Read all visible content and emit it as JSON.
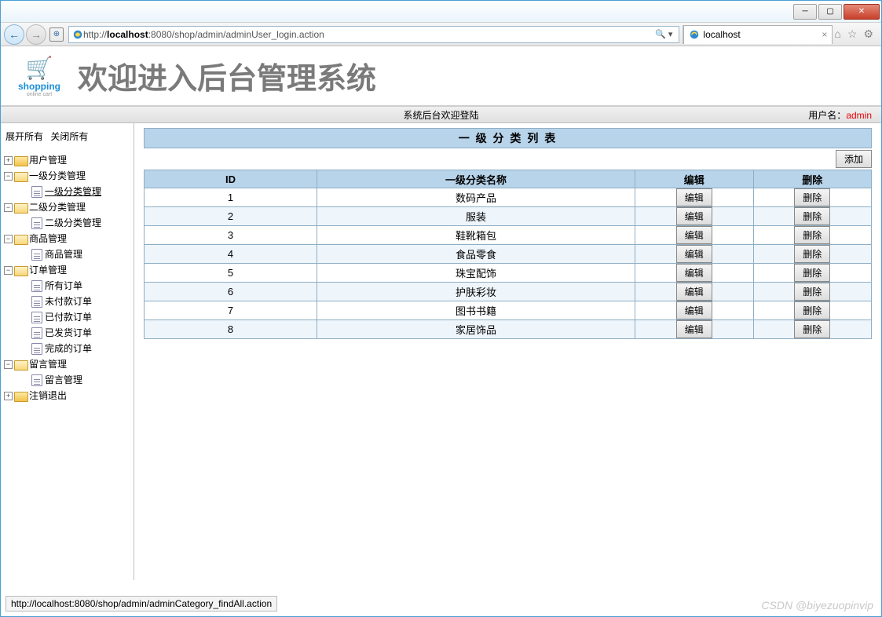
{
  "window": {
    "url_prefix": "http://",
    "url_host": "localhost",
    "url_rest": ":8080/shop/admin/adminUser_login.action",
    "tab_title": "localhost",
    "search_hint": "🔍 ▾"
  },
  "tool_icons": {
    "home": "⌂",
    "star": "☆",
    "gear": "⚙"
  },
  "header": {
    "logo_name": "shopping",
    "logo_sub": "online cart",
    "title": "欢迎进入后台管理系统"
  },
  "info_bar": {
    "center": "系统后台欢迎登陆",
    "user_label": "用户名：",
    "user_name": "admin"
  },
  "sidebar": {
    "expand_all": "展开所有",
    "collapse_all": "关闭所有",
    "nodes": [
      {
        "label": "用户管理",
        "state": "plus",
        "children": []
      },
      {
        "label": "一级分类管理",
        "state": "minus",
        "children": [
          {
            "label": "一级分类管理",
            "active": true
          }
        ]
      },
      {
        "label": "二级分类管理",
        "state": "minus",
        "children": [
          {
            "label": "二级分类管理"
          }
        ]
      },
      {
        "label": "商品管理",
        "state": "minus",
        "children": [
          {
            "label": "商品管理"
          }
        ]
      },
      {
        "label": "订单管理",
        "state": "minus",
        "children": [
          {
            "label": "所有订单"
          },
          {
            "label": "未付款订单"
          },
          {
            "label": "已付款订单"
          },
          {
            "label": "已发货订单"
          },
          {
            "label": "完成的订单"
          }
        ]
      },
      {
        "label": "留言管理",
        "state": "minus",
        "children": [
          {
            "label": "留言管理"
          }
        ]
      },
      {
        "label": "注销退出",
        "state": "plus",
        "children": []
      }
    ]
  },
  "content": {
    "list_title": "一 级 分 类 列 表",
    "add_label": "添加",
    "columns": {
      "id": "ID",
      "name": "一级分类名称",
      "edit": "编辑",
      "delete": "删除"
    },
    "edit_btn": "编辑",
    "delete_btn": "删除",
    "rows": [
      {
        "id": "1",
        "name": "数码产品"
      },
      {
        "id": "2",
        "name": "服装"
      },
      {
        "id": "3",
        "name": "鞋靴箱包"
      },
      {
        "id": "4",
        "name": "食品零食"
      },
      {
        "id": "5",
        "name": "珠宝配饰"
      },
      {
        "id": "6",
        "name": "护肤彩妆"
      },
      {
        "id": "7",
        "name": "图书书籍"
      },
      {
        "id": "8",
        "name": "家居饰品"
      }
    ]
  },
  "status_bar": "http://localhost:8080/shop/admin/adminCategory_findAll.action",
  "watermark": "CSDN @biyezuopinvip"
}
